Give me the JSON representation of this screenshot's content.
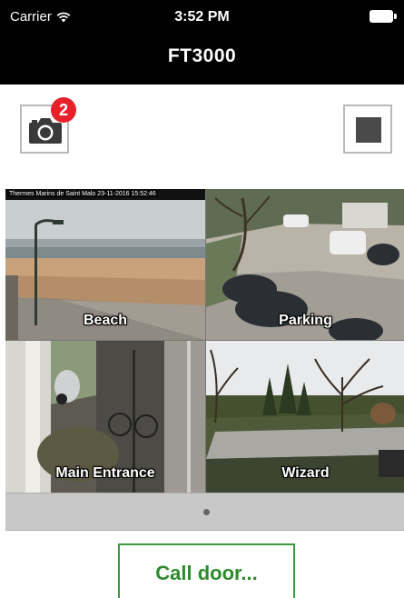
{
  "status_bar": {
    "carrier": "Carrier",
    "time": "3:52 PM"
  },
  "nav": {
    "title": "FT3000"
  },
  "toolbar": {
    "snapshot_badge": "2"
  },
  "cameras": [
    {
      "label": "Beach",
      "overlay": "Thermes Marins de Saint Malo 23-11-2016 15:52:46"
    },
    {
      "label": "Parking"
    },
    {
      "label": "Main Entrance"
    },
    {
      "label": "Wizard"
    }
  ],
  "pager": {
    "pages": 1,
    "current": 1
  },
  "call_door": {
    "label": "Call door..."
  },
  "colors": {
    "accent_green": "#2d8a2d",
    "badge_red": "#e8202a",
    "bar_black": "#000000"
  }
}
